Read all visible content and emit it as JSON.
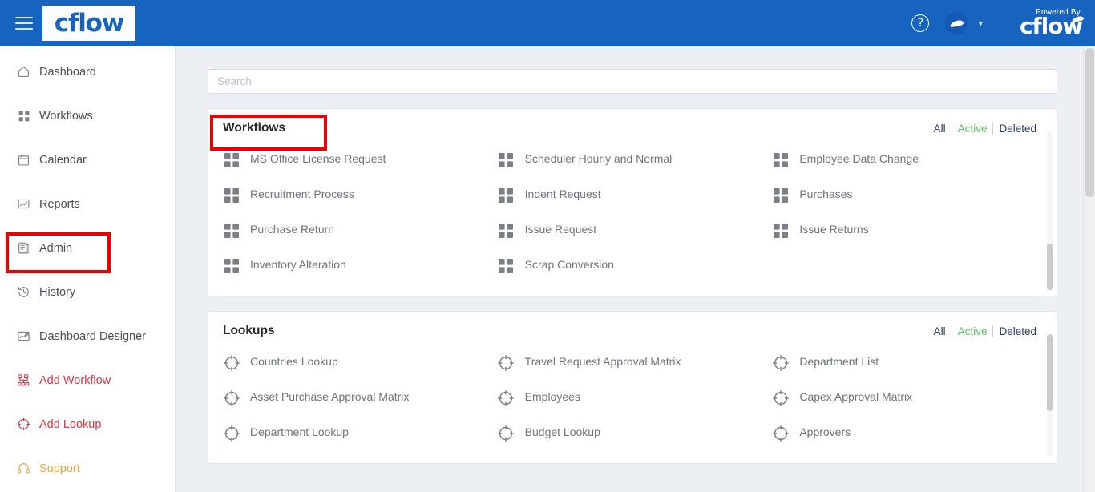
{
  "header": {
    "menu_icon": "hamburger-menu-icon",
    "logo_text": "cflow",
    "help_icon": "help-circle-icon",
    "avatar_icon": "user-avatar-icon",
    "caret_icon": "chevron-down-icon",
    "powered_by_label": "Powered By",
    "powered_logo_text": "cflow",
    "brand_color": "#1764c0"
  },
  "sidebar": {
    "items": [
      {
        "label": "Dashboard",
        "icon": "home-icon",
        "style": "default"
      },
      {
        "label": "Workflows",
        "icon": "grid-icon",
        "style": "default"
      },
      {
        "label": "Calendar",
        "icon": "calendar-icon",
        "style": "default"
      },
      {
        "label": "Reports",
        "icon": "report-icon",
        "style": "default"
      },
      {
        "label": "Admin",
        "icon": "admin-book-icon",
        "style": "default"
      },
      {
        "label": "History",
        "icon": "history-clock-icon",
        "style": "default"
      },
      {
        "label": "Dashboard Designer",
        "icon": "dashboard-designer-icon",
        "style": "default"
      },
      {
        "label": "Add Workflow",
        "icon": "add-workflow-icon",
        "style": "red"
      },
      {
        "label": "Add Lookup",
        "icon": "add-lookup-icon",
        "style": "red"
      },
      {
        "label": "Support",
        "icon": "headset-icon",
        "style": "orange"
      }
    ]
  },
  "search": {
    "placeholder": "Search",
    "value": ""
  },
  "workflows_panel": {
    "title": "Workflows",
    "filters": [
      {
        "label": "All",
        "active": false
      },
      {
        "label": "Active",
        "active": true
      },
      {
        "label": "Deleted",
        "active": false
      }
    ],
    "items": [
      "MS Office License Request",
      "Scheduler Hourly and Normal",
      "Employee Data Change",
      "Recruitment Process",
      "Indent Request",
      "Purchases",
      "Purchase Return",
      "Issue Request",
      "Issue Returns",
      "Inventory Alteration",
      "Scrap Conversion"
    ]
  },
  "lookups_panel": {
    "title": "Lookups",
    "filters": [
      {
        "label": "All",
        "active": false
      },
      {
        "label": "Active",
        "active": true
      },
      {
        "label": "Deleted",
        "active": false
      }
    ],
    "items": [
      "Countries Lookup",
      "Travel Request Approval Matrix",
      "Department List",
      "Asset Purchase Approval Matrix",
      "Employees",
      "Capex Approval Matrix",
      "Department Lookup",
      "Budget Lookup",
      "Approvers"
    ]
  },
  "annotations": [
    {
      "name": "admin-highlight",
      "color": "#ef0000"
    },
    {
      "name": "workflows-highlight",
      "color": "#ef0000"
    }
  ]
}
